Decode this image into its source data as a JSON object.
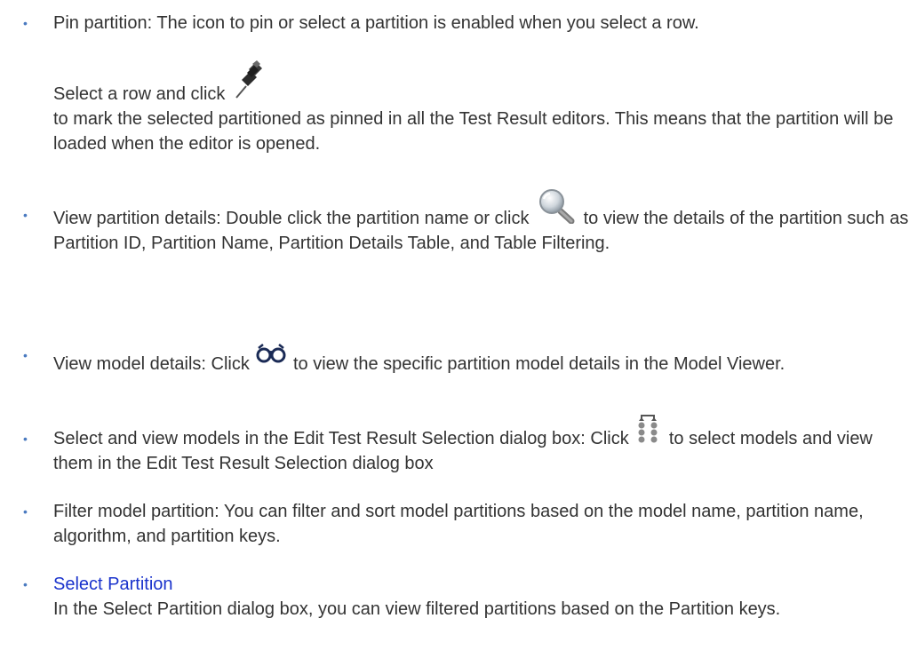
{
  "bullet_glyph": "•",
  "items": [
    {
      "line1": "Pin partition: The icon to pin or select a partition is enabled when you select a row.",
      "line2": "Select a row and click",
      "para": "to mark the selected partitioned as pinned in all the Test Result editors. This means that the partition will be loaded when the editor is opened.",
      "icon": "pushpin-icon"
    },
    {
      "before": "View partition details: Double click the partition name or click",
      "after": "to view the details of the partition such as Partition ID, Partition Name, Partition Details Table, and Table Filtering.",
      "icon": "magnifier-icon"
    },
    {
      "before": "View model details: Click",
      "after": "to view the specific partition model details in the Model Viewer.",
      "icon": "glasses-icon"
    },
    {
      "before": "Select and view models in the Edit Test Result Selection dialog box: Click",
      "after": "to select models and view them in the Edit Test Result Selection dialog box",
      "icon": "model-selection-icon"
    },
    {
      "text": "Filter model partition: You can filter and sort model partitions based on the model name, partition name, algorithm, and partition keys."
    },
    {
      "link": "Select Partition",
      "text": "In the Select Partition dialog box, you can view filtered partitions based on the Partition keys."
    }
  ],
  "colors": {
    "text": "#333333",
    "bullet": "#4a7ac0",
    "link": "#1a33cc"
  }
}
